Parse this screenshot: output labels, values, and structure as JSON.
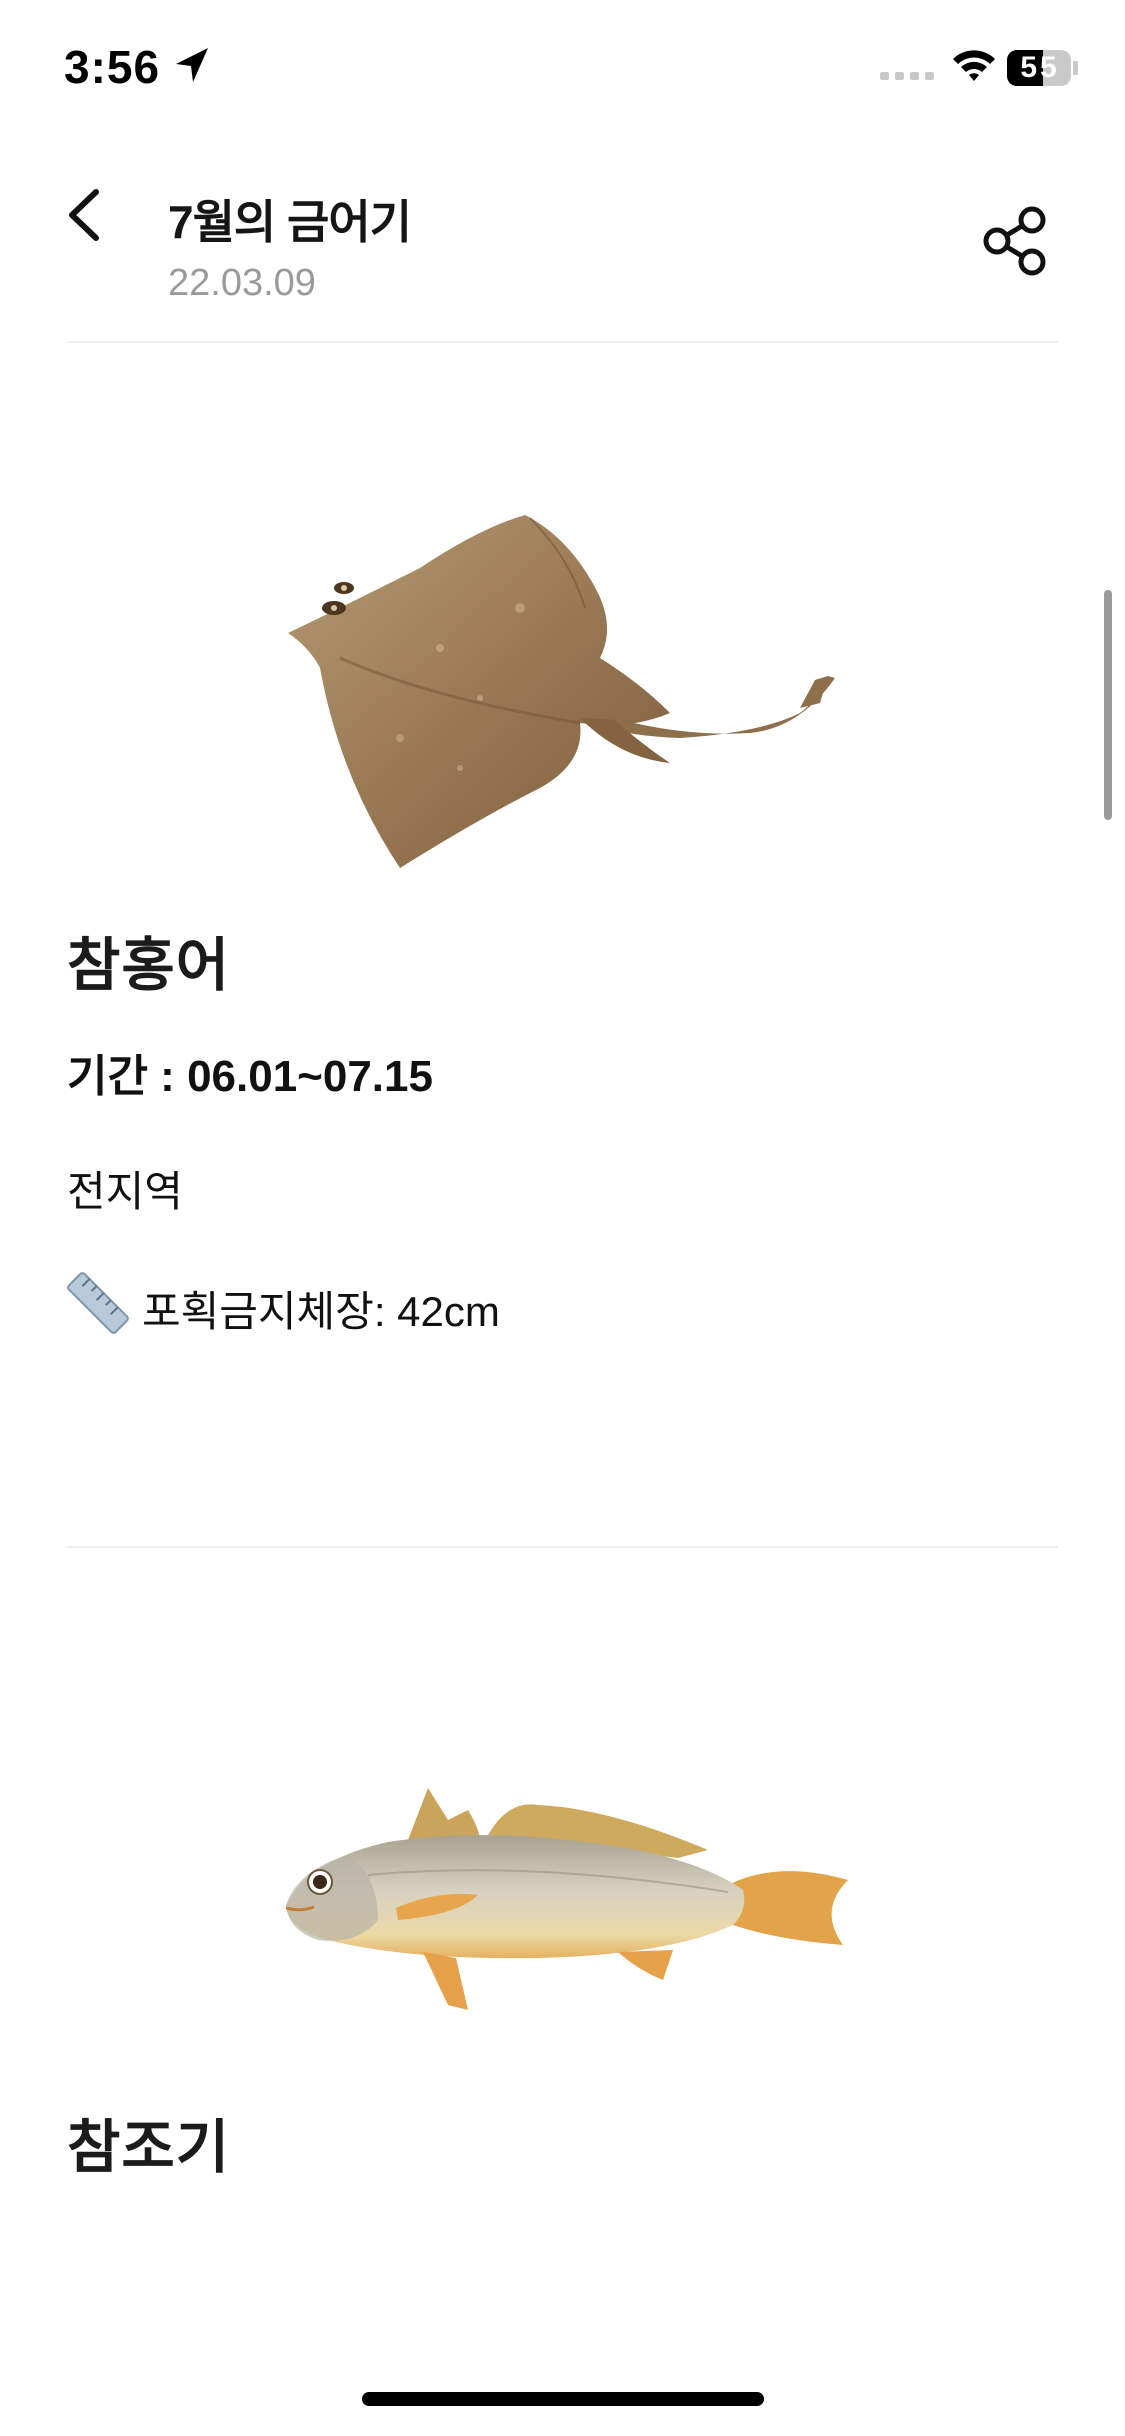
{
  "status_bar": {
    "time": "3:56",
    "battery": "55",
    "location_icon": "location-arrow-icon",
    "wifi_icon": "wifi-icon",
    "signal_icon": "cellular-signal-icon",
    "battery_icon": "battery-icon"
  },
  "header": {
    "back_icon": "chevron-left-icon",
    "title": "7월의 금어기",
    "date": "22.03.09",
    "share_icon": "share-icon"
  },
  "fish": [
    {
      "name": "참홍어",
      "period_label": "기간 : ",
      "period": "06.01~07.15",
      "region": "전지역",
      "size_icon": "ruler-icon",
      "size_text": "포획금지체장: 42cm",
      "image": "skate-ray-image"
    },
    {
      "name": "참조기",
      "image": "yellow-croaker-image"
    }
  ],
  "colors": {
    "ray_body": "#9a7a55",
    "croaker_body": "#cfc8b8",
    "croaker_fin": "#e0a040",
    "divider": "#eeeeee",
    "date_text": "#9a9a9a"
  }
}
